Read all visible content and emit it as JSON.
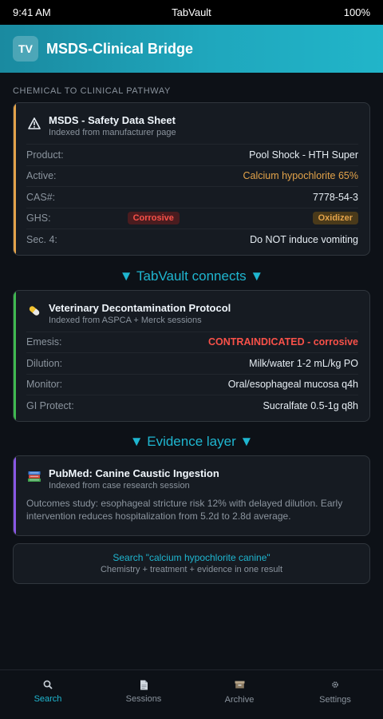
{
  "status_bar": {
    "time": "9:41 AM",
    "carrier": "TabVault",
    "battery": "100%"
  },
  "header": {
    "badge": "TV",
    "title": "MSDS-Clinical Bridge"
  },
  "section_label": "CHEMICAL TO CLINICAL PATHWAY",
  "msds_card": {
    "icon": "warning-icon",
    "title": "MSDS - Safety Data Sheet",
    "subtitle": "Indexed from manufacturer page",
    "rows": [
      {
        "label": "Product:",
        "value": "Pool Shock - HTH Super"
      },
      {
        "label": "Active:",
        "value": "Calcium hypochlorite 65%"
      },
      {
        "label": "CAS#:",
        "value": "7778-54-3"
      },
      {
        "label": "GHS:",
        "tags": [
          "Corrosive",
          "Oxidizer"
        ]
      },
      {
        "label": "Sec. 4:",
        "value": "Do NOT induce vomiting"
      }
    ]
  },
  "connector_1": "▼ TabVault connects ▼",
  "vet_card": {
    "icon": "pill-icon",
    "title": "Veterinary Decontamination Protocol",
    "subtitle": "Indexed from ASPCA + Merck sessions",
    "rows": [
      {
        "label": "Emesis:",
        "value": "CONTRAINDICATED - corrosive"
      },
      {
        "label": "Dilution:",
        "value": "Milk/water 1-2 mL/kg PO"
      },
      {
        "label": "Monitor:",
        "value": "Oral/esophageal mucosa q4h"
      },
      {
        "label": "GI Protect:",
        "value": "Sucralfate 0.5-1g q8h"
      }
    ]
  },
  "connector_2": "▼ Evidence layer ▼",
  "pubmed_card": {
    "icon": "books-icon",
    "title": "PubMed: Canine Caustic Ingestion",
    "subtitle": "Indexed from case research session",
    "body": "Outcomes study: esophageal stricture risk 12% with delayed dilution. Early intervention reduces hospitalization from 5.2d to 2.8d average."
  },
  "search_card": {
    "query": "Search \"calcium hypochlorite canine\"",
    "subtitle": "Chemistry + treatment + evidence in one result"
  },
  "nav": [
    {
      "label": "Search",
      "icon": "search-icon",
      "active": true
    },
    {
      "label": "Sessions",
      "icon": "document-icon",
      "active": false
    },
    {
      "label": "Archive",
      "icon": "archive-icon",
      "active": false
    },
    {
      "label": "Settings",
      "icon": "gear-icon",
      "active": false
    }
  ],
  "colors": {
    "accent": "#1fb6d0",
    "msds_border": "#e3a34a",
    "vet_border": "#3fb950",
    "pubmed_border": "#8957e5",
    "danger": "#f85149"
  }
}
